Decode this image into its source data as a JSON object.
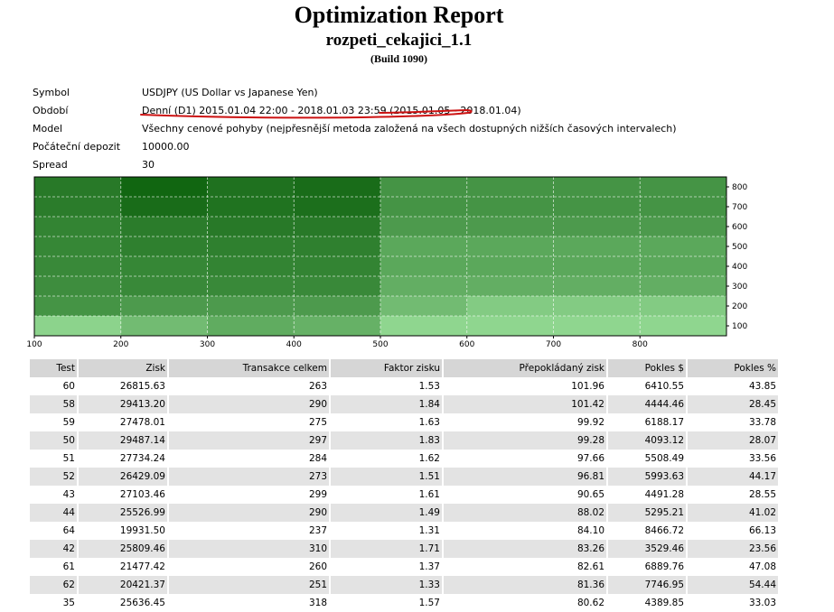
{
  "report": {
    "title": "Optimization Report",
    "subtitle": "rozpeti_cekajici_1.1",
    "build": "(Build 1090)"
  },
  "info": [
    {
      "label": "Symbol",
      "value": "USDJPY (US Dollar vs Japanese Yen)"
    },
    {
      "label": "Období",
      "value": "Denní (D1) 2015.01.04 22:00 - 2018.01.03 23:59 (2015.01.05 - 2018.01.04)"
    },
    {
      "label": "Model",
      "value": "Všechny cenové pohyby (nejpřesnější metoda založená na všech dostupných nižších časových intervalech)"
    },
    {
      "label": "Počáteční depozit",
      "value": "10000.00"
    },
    {
      "label": "Spread",
      "value": "30"
    }
  ],
  "annotation_color": "#cc1111",
  "chart_data": {
    "type": "heatmap",
    "x_ticks": [
      "100",
      "200",
      "300",
      "400",
      "500",
      "600",
      "700",
      "800"
    ],
    "y_ticks": [
      "800",
      "700",
      "600",
      "500",
      "400",
      "300",
      "200",
      "100"
    ],
    "grid": true,
    "color_scale": {
      "low": "#9ee39e",
      "high": "#0a5f0a"
    },
    "rows": [
      [
        0.8,
        0.95,
        0.86,
        0.9,
        0.6,
        0.6,
        0.6,
        0.6
      ],
      [
        0.78,
        0.9,
        0.85,
        0.88,
        0.6,
        0.6,
        0.6,
        0.6
      ],
      [
        0.72,
        0.78,
        0.8,
        0.8,
        0.55,
        0.55,
        0.55,
        0.55
      ],
      [
        0.7,
        0.75,
        0.75,
        0.75,
        0.45,
        0.45,
        0.45,
        0.45
      ],
      [
        0.68,
        0.7,
        0.72,
        0.72,
        0.45,
        0.45,
        0.45,
        0.45
      ],
      [
        0.65,
        0.68,
        0.68,
        0.68,
        0.4,
        0.4,
        0.4,
        0.4
      ],
      [
        0.6,
        0.55,
        0.55,
        0.55,
        0.3,
        0.18,
        0.18,
        0.18
      ],
      [
        0.12,
        0.3,
        0.42,
        0.38,
        0.1,
        0.1,
        0.1,
        0.1
      ]
    ]
  },
  "table": {
    "columns": [
      "Test",
      "Zisk",
      "Transakce celkem",
      "Faktor zisku",
      "Přepokládaný zisk",
      "Pokles $",
      "Pokles %"
    ],
    "rows": [
      [
        "60",
        "26815.63",
        "263",
        "1.53",
        "101.96",
        "6410.55",
        "43.85"
      ],
      [
        "58",
        "29413.20",
        "290",
        "1.84",
        "101.42",
        "4444.46",
        "28.45"
      ],
      [
        "59",
        "27478.01",
        "275",
        "1.63",
        "99.92",
        "6188.17",
        "33.78"
      ],
      [
        "50",
        "29487.14",
        "297",
        "1.83",
        "99.28",
        "4093.12",
        "28.07"
      ],
      [
        "51",
        "27734.24",
        "284",
        "1.62",
        "97.66",
        "5508.49",
        "33.56"
      ],
      [
        "52",
        "26429.09",
        "273",
        "1.51",
        "96.81",
        "5993.63",
        "44.17"
      ],
      [
        "43",
        "27103.46",
        "299",
        "1.61",
        "90.65",
        "4491.28",
        "28.55"
      ],
      [
        "44",
        "25526.99",
        "290",
        "1.49",
        "88.02",
        "5295.21",
        "41.02"
      ],
      [
        "64",
        "19931.50",
        "237",
        "1.31",
        "84.10",
        "8466.72",
        "66.13"
      ],
      [
        "42",
        "25809.46",
        "310",
        "1.71",
        "83.26",
        "3529.46",
        "23.56"
      ],
      [
        "61",
        "21477.42",
        "260",
        "1.37",
        "82.61",
        "6889.76",
        "47.08"
      ],
      [
        "62",
        "20421.37",
        "251",
        "1.33",
        "81.36",
        "7746.95",
        "54.44"
      ],
      [
        "35",
        "25636.45",
        "318",
        "1.57",
        "80.62",
        "4389.85",
        "33.03"
      ]
    ]
  }
}
